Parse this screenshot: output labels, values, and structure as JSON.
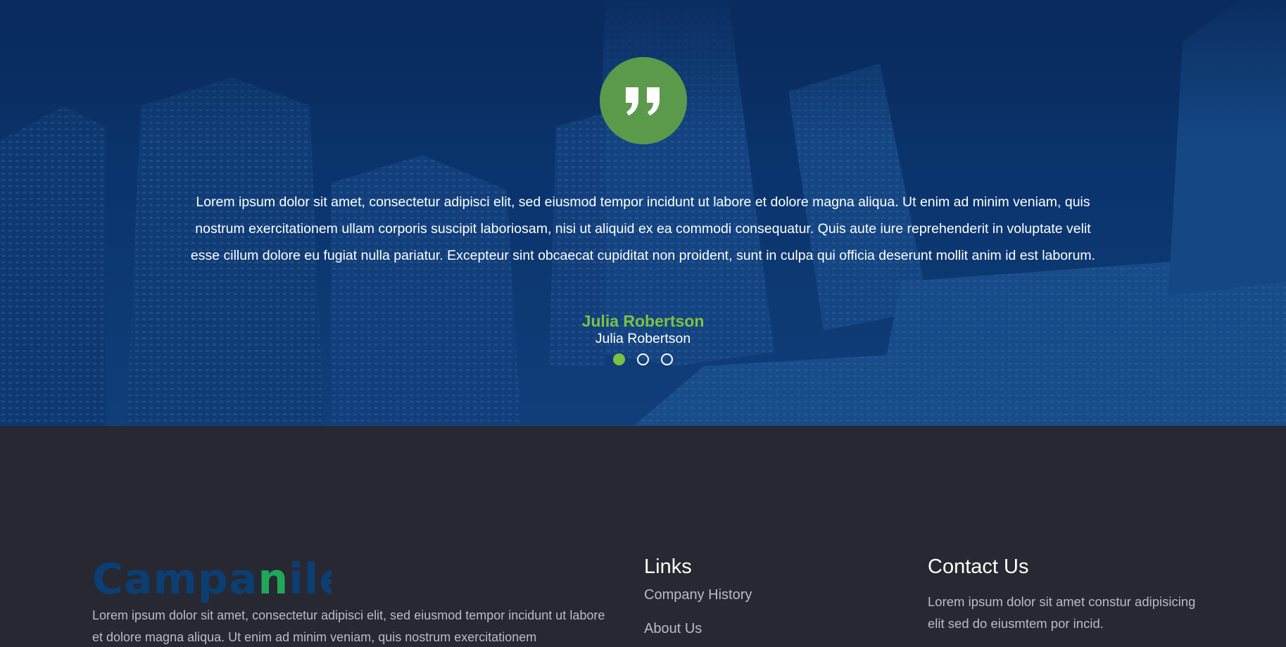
{
  "colors": {
    "accent_green": "#7cc242",
    "badge_green": "#5c9a4b",
    "hero_blue": "#0c3a72",
    "footer_bg": "#272831",
    "logo_blue": "#0b3f73",
    "logo_green": "#1fa85a"
  },
  "testimonial": {
    "quote_icon": "quote-icon",
    "text": "Lorem ipsum dolor sit amet, consectetur adipisci elit, sed eiusmod tempor incidunt ut labore et dolore magna aliqua. Ut enim ad minim veniam, quis nostrum exercitationem ullam corporis suscipit laboriosam, nisi ut aliquid ex ea commodi consequatur. Quis aute iure reprehenderit in voluptate velit esse cillum dolore eu fugiat nulla pariatur. Excepteur sint obcaecat cupiditat non proident, sunt in culpa qui officia deserunt mollit anim id est laborum.",
    "author_name": "Julia Robertson",
    "author_role": "Julia Robertson",
    "slides_total": 3,
    "active_slide": 1
  },
  "footer": {
    "logo": {
      "part1": "Campa",
      "part2": "n",
      "part3": "ile"
    },
    "about_text": "Lorem ipsum dolor sit amet, consectetur adipisci elit, sed eiusmod tempor incidunt ut labore et dolore magna aliqua. Ut enim ad minim veniam, quis nostrum exercitationem",
    "links": {
      "title": "Links",
      "items": [
        {
          "label": "Company History"
        },
        {
          "label": "About Us"
        }
      ]
    },
    "contact": {
      "title": "Contact Us",
      "text": "Lorem ipsum dolor sit amet constur adipisicing elit sed do eiusmtem por incid."
    }
  }
}
